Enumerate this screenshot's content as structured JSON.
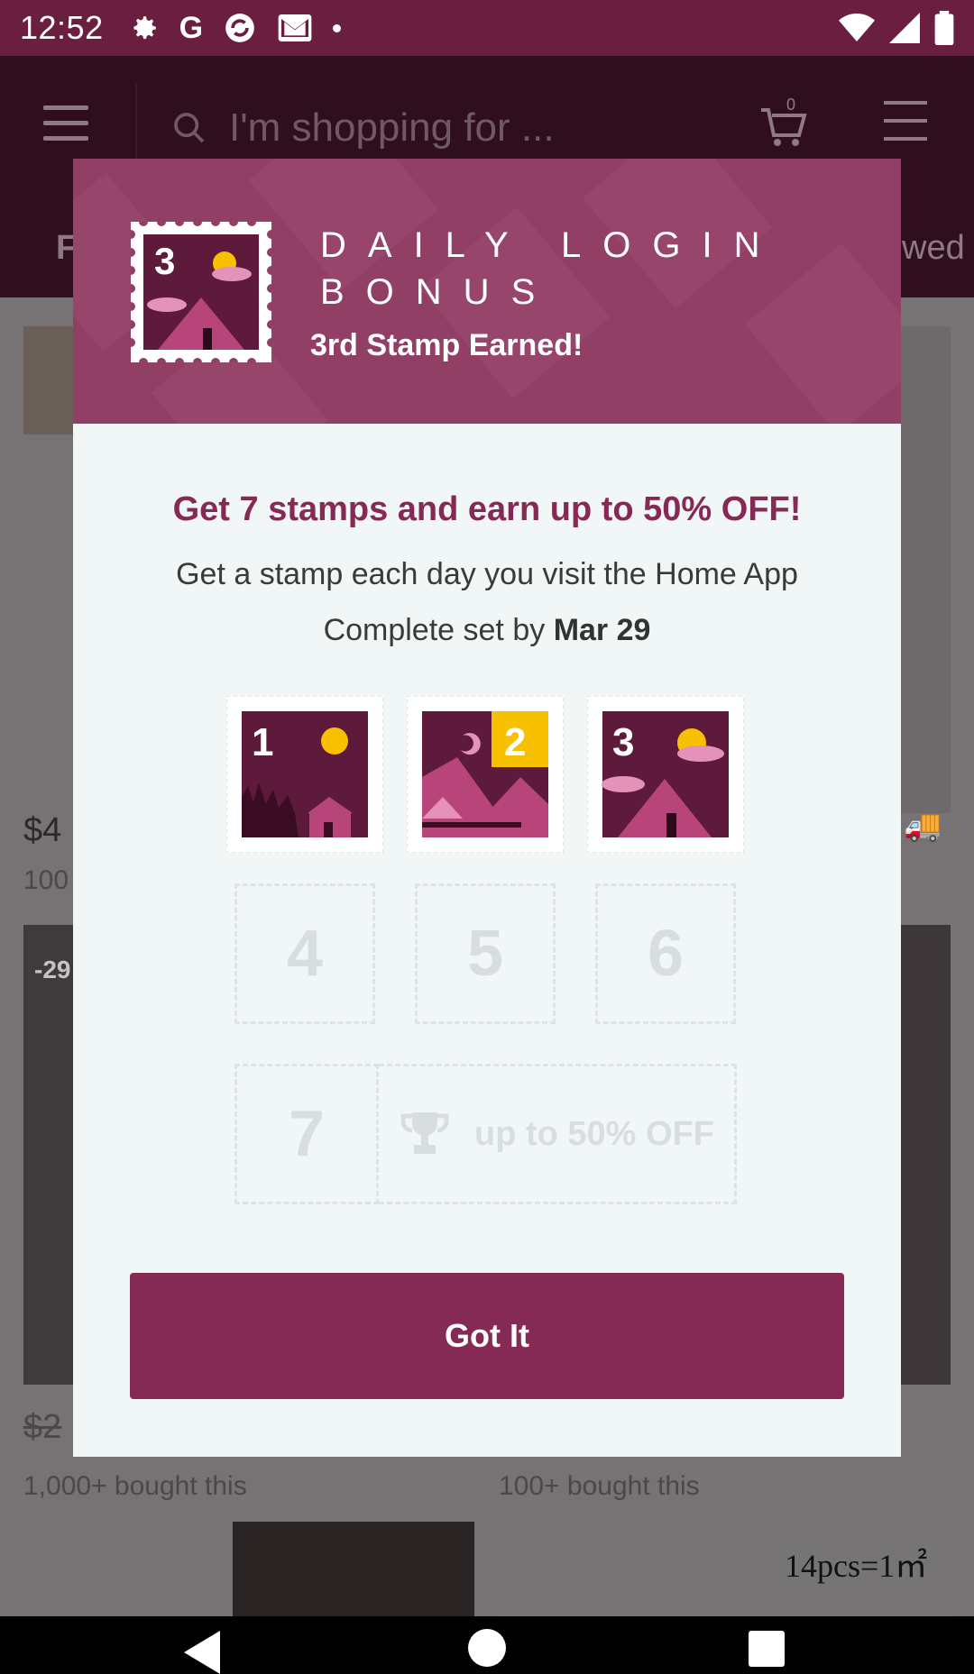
{
  "status_bar": {
    "time": "12:52",
    "notification_icons": [
      "gear-icon",
      "google-icon",
      "sync-icon",
      "gmail-icon",
      "dot-icon"
    ],
    "system_icons": [
      "wifi-icon",
      "signal-icon",
      "battery-icon"
    ]
  },
  "app_bar": {
    "search_placeholder": "I'm shopping for ...",
    "cart_count": "0",
    "tab_fragment_left": "F",
    "tab_fragment_right": "wed"
  },
  "background": {
    "price_left": "$4",
    "count_left": "100",
    "badge": "-29",
    "price_left_2": "$2",
    "bought_left": "1,000+ bought this",
    "bought_right": "100+ bought this",
    "tiles_label": "14pcs=1㎡"
  },
  "modal": {
    "header": {
      "title": "DAILY LOGIN BONUS",
      "subtitle": "3rd Stamp Earned!",
      "stamp_number": "3"
    },
    "headline": "Get 7 stamps and earn up to 50% OFF!",
    "description": "Get a stamp each day you visit the Home App",
    "deadline_prefix": "Complete set by ",
    "deadline_date": "Mar 29",
    "stamps_earned": [
      {
        "day": "1"
      },
      {
        "day": "2"
      },
      {
        "day": "3"
      }
    ],
    "stamps_remaining": [
      "4",
      "5",
      "6",
      "7"
    ],
    "reward_text": "up to 50% OFF",
    "button_label": "Got It"
  },
  "colors": {
    "primary": "#852a54",
    "header_bg": "#923f66",
    "stamp_dark": "#5e1a3b",
    "stamp_pink": "#b8457a",
    "accent_yellow": "#f7c000"
  }
}
